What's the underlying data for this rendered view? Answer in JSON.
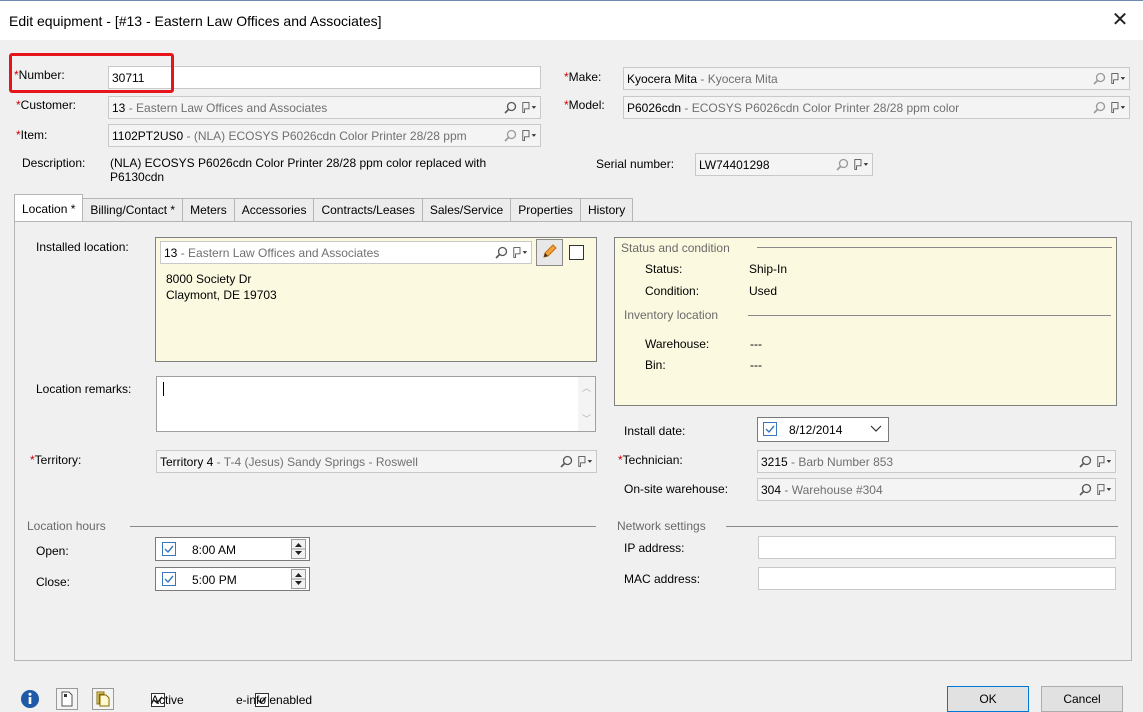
{
  "window": {
    "title": "Edit equipment - [#13 - Eastern Law Offices and Associates]"
  },
  "header": {
    "number": {
      "label": "Number:",
      "value": "30711"
    },
    "customer": {
      "label": "Customer:",
      "code": "13",
      "desc": " - Eastern Law Offices and Associates"
    },
    "item": {
      "label": "Item:",
      "code": "1102PT2US0",
      "desc": " - (NLA) ECOSYS P6026cdn  Color Printer 28/28 ppm"
    },
    "description": {
      "label": "Description:",
      "line1": "(NLA) ECOSYS P6026cdn  Color Printer 28/28 ppm color replaced with",
      "line2": "P6130cdn"
    },
    "make": {
      "label": "Make:",
      "code": "Kyocera Mita",
      "desc": " - Kyocera Mita"
    },
    "model": {
      "label": "Model:",
      "code": "P6026cdn",
      "desc": " - ECOSYS P6026cdn  Color Printer 28/28 ppm color"
    },
    "serial": {
      "label": "Serial number:",
      "value": "LW74401298"
    }
  },
  "tabs": [
    {
      "label": "Location *"
    },
    {
      "label": "Billing/Contact *"
    },
    {
      "label": "Meters"
    },
    {
      "label": "Accessories"
    },
    {
      "label": "Contracts/Leases"
    },
    {
      "label": "Sales/Service"
    },
    {
      "label": "Properties"
    },
    {
      "label": "History"
    }
  ],
  "location": {
    "installed_label": "Installed location:",
    "installed_code": "13",
    "installed_desc": " - Eastern Law Offices and Associates",
    "address_line1": "8000 Society Dr",
    "address_line2": "Claymont, DE 19703",
    "remarks_label": "Location remarks:",
    "remarks_value": "",
    "territory_label": "Territory:",
    "territory_code": "Territory 4",
    "territory_desc": " - T-4 (Jesus) Sandy Springs - Roswell",
    "hours_title": "Location hours",
    "open_label": "Open:",
    "open_value": "8:00 AM",
    "close_label": "Close:",
    "close_value": "5:00 PM"
  },
  "status": {
    "group_title": "Status and condition",
    "status_label": "Status:",
    "status_value": "Ship-In",
    "condition_label": "Condition:",
    "condition_value": "Used",
    "inventory_title": "Inventory location",
    "warehouse_label": "Warehouse:",
    "warehouse_value": "---",
    "bin_label": "Bin:",
    "bin_value": "---"
  },
  "install": {
    "date_label": "Install date:",
    "date_value": "8/12/2014",
    "technician_label": "Technician:",
    "technician_code": "3215",
    "technician_desc": " - Barb Number 853",
    "onsite_label": "On-site warehouse:",
    "onsite_code": "304",
    "onsite_desc": " - Warehouse #304"
  },
  "network": {
    "title": "Network settings",
    "ip_label": "IP address:",
    "ip_value": "",
    "mac_label": "MAC address:",
    "mac_value": ""
  },
  "footer": {
    "active_label": "Active",
    "einfo_label": "e-info enabled",
    "ok_label": "OK",
    "cancel_label": "Cancel"
  },
  "colors": {
    "required": "#d40000",
    "yellow_panel": "#fbf9e0",
    "highlight_box": "#e8141b",
    "accent": "#0078d7"
  },
  "icons": [
    "search-icon",
    "flag-dropdown-icon",
    "pencil-icon",
    "info-icon",
    "document-icon",
    "copy-icon",
    "close-icon"
  ]
}
